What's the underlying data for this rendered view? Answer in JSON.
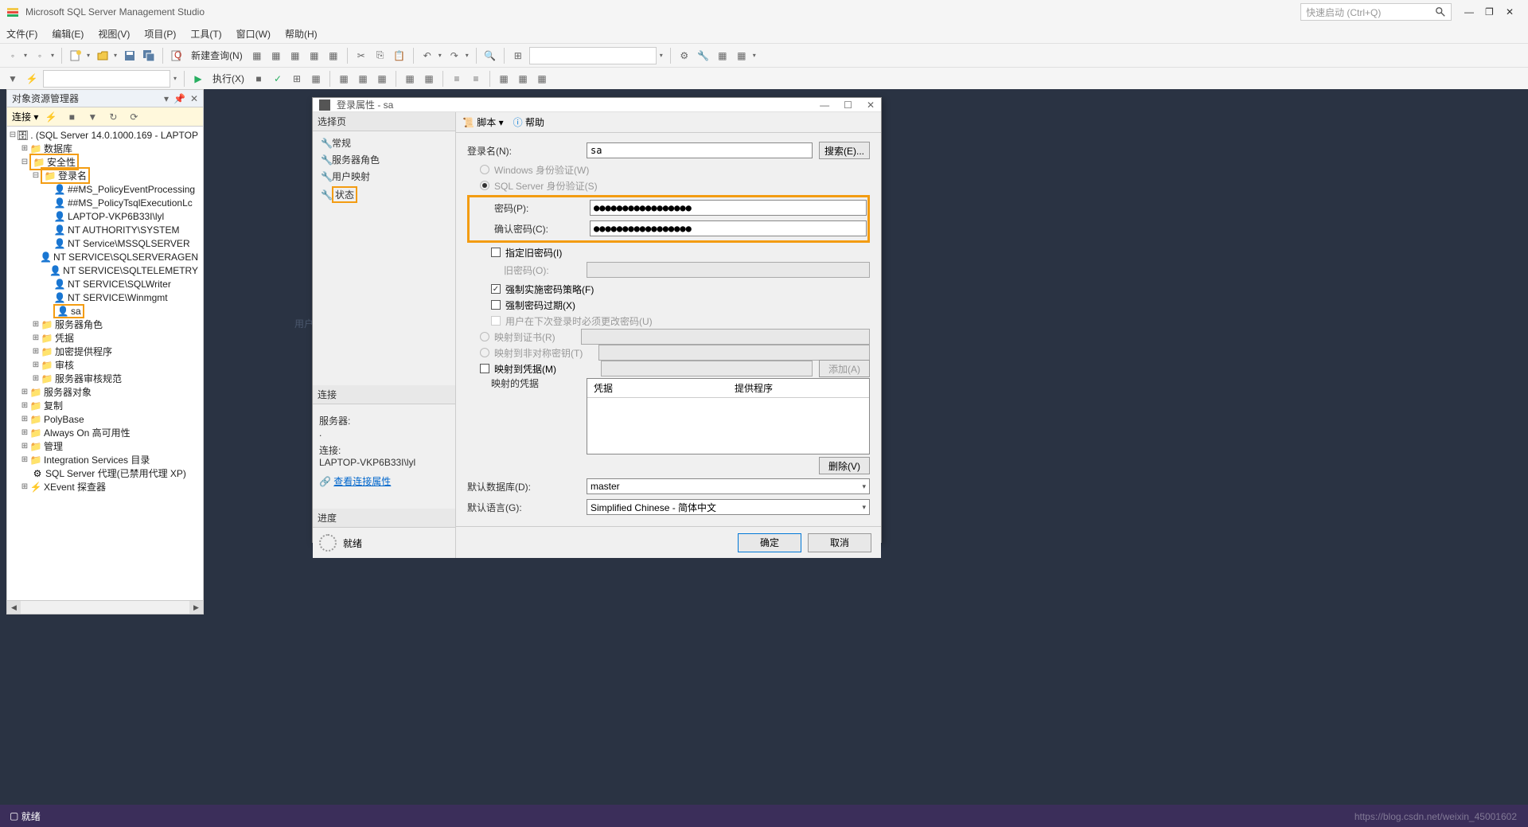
{
  "app": {
    "title": "Microsoft SQL Server Management Studio",
    "quick_launch_placeholder": "快速启动 (Ctrl+Q)"
  },
  "menu": [
    "文件(F)",
    "编辑(E)",
    "视图(V)",
    "项目(P)",
    "工具(T)",
    "窗口(W)",
    "帮助(H)"
  ],
  "toolbar": {
    "new_query": "新建查询(N)",
    "execute": "执行(X)"
  },
  "object_explorer": {
    "title": "对象资源管理器",
    "connect": "连接",
    "root": ". (SQL Server 14.0.1000.169 - LAPTOP",
    "nodes": {
      "database": "数据库",
      "security": "安全性",
      "logins": "登录名",
      "login_items": [
        "##MS_PolicyEventProcessing",
        "##MS_PolicyTsqlExecutionLc",
        "LAPTOP-VKP6B33I\\lyl",
        "NT AUTHORITY\\SYSTEM",
        "NT Service\\MSSQLSERVER",
        "NT SERVICE\\SQLSERVERAGEN",
        "NT SERVICE\\SQLTELEMETRY",
        "NT SERVICE\\SQLWriter",
        "NT SERVICE\\Winmgmt",
        "sa"
      ],
      "server_roles": "服务器角色",
      "credentials": "凭据",
      "crypto_providers": "加密提供程序",
      "audits": "审核",
      "server_audit_specs": "服务器审核规范",
      "server_objects": "服务器对象",
      "replication": "复制",
      "polybase": "PolyBase",
      "always_on": "Always On 高可用性",
      "management": "管理",
      "integration_services": "Integration Services 目录",
      "sql_agent": "SQL Server 代理(已禁用代理 XP)",
      "xevent": "XEvent 探查器"
    }
  },
  "ghost": "用户映射(W)",
  "dialog": {
    "title": "登录属性 - sa",
    "select_page": "选择页",
    "pages": [
      "常规",
      "服务器角色",
      "用户映射",
      "状态"
    ],
    "connection_section": "连接",
    "server_label": "服务器:",
    "server_value": ".",
    "conn_label": "连接:",
    "conn_value": "LAPTOP-VKP6B33I\\lyl",
    "view_conn_props": "查看连接属性",
    "progress_section": "进度",
    "progress_status": "就绪",
    "script": "脚本",
    "help": "帮助",
    "form": {
      "login_name_label": "登录名(N):",
      "login_name_value": "sa",
      "search_btn": "搜索(E)...",
      "windows_auth": "Windows 身份验证(W)",
      "sql_auth": "SQL Server 身份验证(S)",
      "password_label": "密码(P):",
      "password_value": "●●●●●●●●●●●●●●●●●",
      "confirm_password_label": "确认密码(C):",
      "confirm_password_value": "●●●●●●●●●●●●●●●●●",
      "specify_old_pw": "指定旧密码(I)",
      "old_pw_label": "旧密码(O):",
      "enforce_policy": "强制实施密码策略(F)",
      "enforce_expiration": "强制密码过期(X)",
      "must_change": "用户在下次登录时必须更改密码(U)",
      "map_cert": "映射到证书(R)",
      "map_asym": "映射到非对称密钥(T)",
      "map_cred": "映射到凭据(M)",
      "add_btn": "添加(A)",
      "mapped_creds": "映射的凭据",
      "cred_col1": "凭据",
      "cred_col2": "提供程序",
      "remove_btn": "删除(V)",
      "default_db_label": "默认数据库(D):",
      "default_db_value": "master",
      "default_lang_label": "默认语言(G):",
      "default_lang_value": "Simplified Chinese - 简体中文"
    },
    "ok": "确定",
    "cancel": "取消"
  },
  "statusbar": {
    "ready": "就绪"
  },
  "watermark": "https://blog.csdn.net/weixin_45001602"
}
